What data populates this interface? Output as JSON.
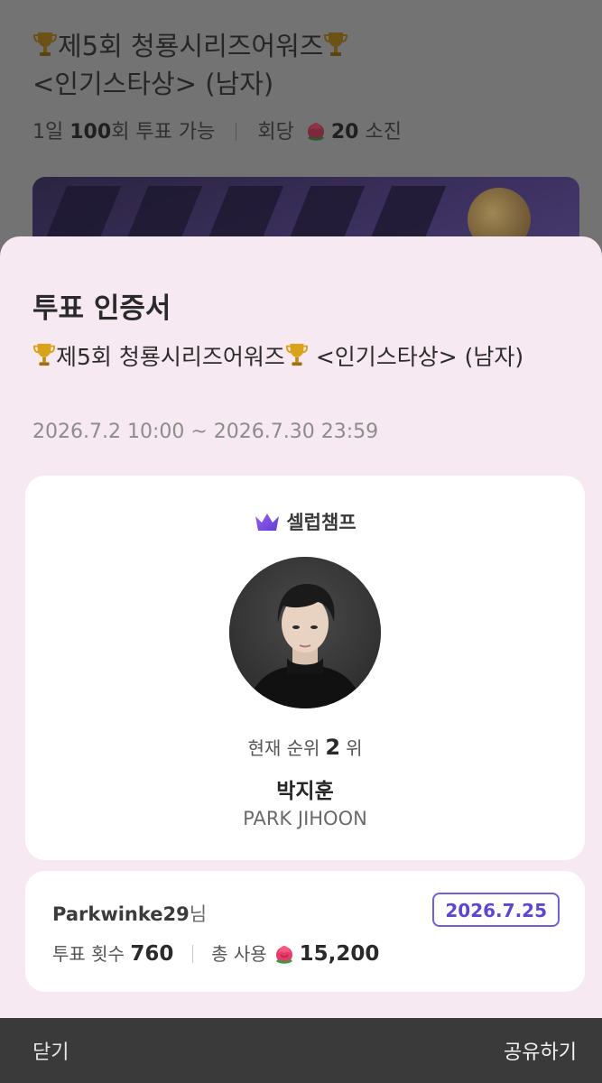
{
  "background": {
    "title_line1": "제5회 청룡시리즈어워즈",
    "title_line2": "<인기스타상> (남자)",
    "meta": {
      "daily_prefix": "1일",
      "daily_count": "100",
      "daily_suffix": "회 투표 가능",
      "per_vote_prefix": "회당",
      "per_vote_count": "20",
      "per_vote_suffix": "소진"
    }
  },
  "sheet": {
    "title": "투표 인증서",
    "event_title_a": "제5회 청룡시리즈어워즈",
    "event_title_b": "<인기스타상> (남자)",
    "period": "2026.7.2 10:00 ~ 2026.7.30 23:59"
  },
  "card": {
    "brand": "셀럽챔프",
    "rank_label": "현재 순위",
    "rank_value": "2",
    "rank_unit": "위",
    "name_ko": "박지훈",
    "name_en": "PARK JIHOON"
  },
  "user": {
    "username": "Parkwinke29",
    "username_suffix": "님",
    "date": "2026.7.25",
    "vote_count_label": "투표 횟수",
    "vote_count": "760",
    "total_used_label": "총 사용",
    "total_used": "15,200"
  },
  "footer": {
    "close_label": "닫기",
    "share_label": "공유하기"
  },
  "icons": {
    "trophy": "trophy-icon",
    "flower": "flower-icon",
    "crown": "crown-icon"
  },
  "colors": {
    "sheet_bg": "#f7e9f1",
    "accent": "#5a49cf",
    "footer_bg": "#3a3a3a"
  }
}
